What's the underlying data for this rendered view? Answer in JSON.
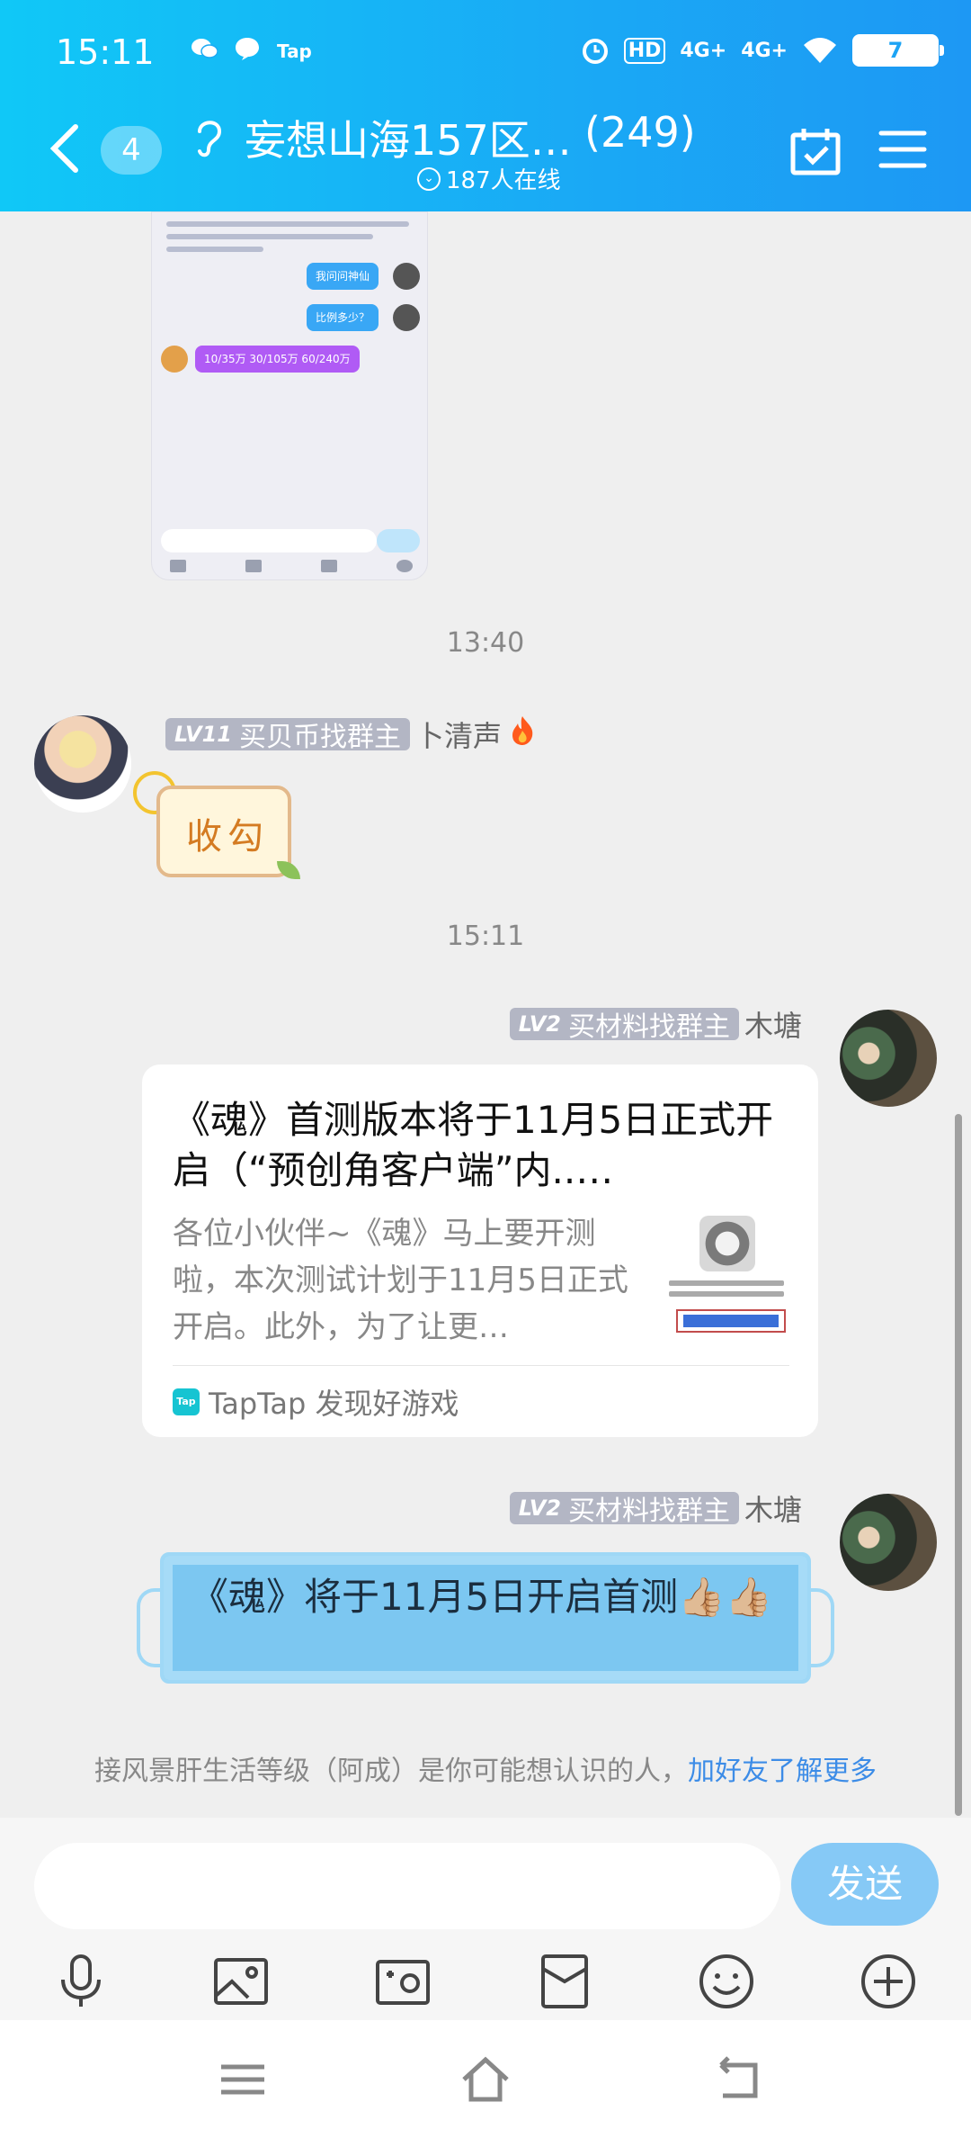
{
  "status_bar": {
    "time": "15:11",
    "left_icons": [
      "wechat-icon",
      "message-icon",
      "taptap-icon"
    ],
    "taptap_label": "Tap",
    "hd_label": "HD",
    "net1": "4G+",
    "net2": "4G+",
    "battery": "7"
  },
  "header": {
    "unread_count": "4",
    "group_name": "妄想山海157区…",
    "member_count": "(249)",
    "online": "187人在线"
  },
  "messages": {
    "ts1": "13:40",
    "msg1": {
      "level": "LV11",
      "role": "买贝币找群主",
      "sender": "卜清声",
      "sticker_text": "收勾"
    },
    "ts2": "15:11",
    "msg2": {
      "level": "LV2",
      "role": "买材料找群主",
      "sender": "木塘",
      "card_title": "《魂》首测版本将于11月5日正式开启（“预创角客户端”内..…",
      "card_desc": "各位小伙伴~《魂》马上要开测啦，本次测试计划于11月5日正式开启。此外，为了让更…",
      "card_source": "TapTap 发现好游戏"
    },
    "msg3": {
      "level": "LV2",
      "role": "买材料找群主",
      "sender": "木塘",
      "text": "《魂》将于11月5日开启首测👍🏼👍🏼"
    },
    "suggest_text": "接风景肝生活等级（阿成）是你可能想认识的人，",
    "suggest_link": "加好友了解更多"
  },
  "screenshot_preview": {
    "bubble1": "我问问神仙",
    "bubble2": "比例多少？",
    "bubble3": "10/35万  30/105万  60/240万"
  },
  "composer": {
    "input_value": "",
    "send_label": "发送",
    "tools": [
      "microphone-icon",
      "image-icon",
      "camera-icon",
      "red-packet-icon",
      "emoji-icon",
      "plus-icon"
    ]
  },
  "nav": [
    "menu-icon",
    "home-icon",
    "back-icon"
  ],
  "colors": {
    "header": "#1aa9f5",
    "send": "#86c9f6",
    "link": "#3c8ce7"
  }
}
